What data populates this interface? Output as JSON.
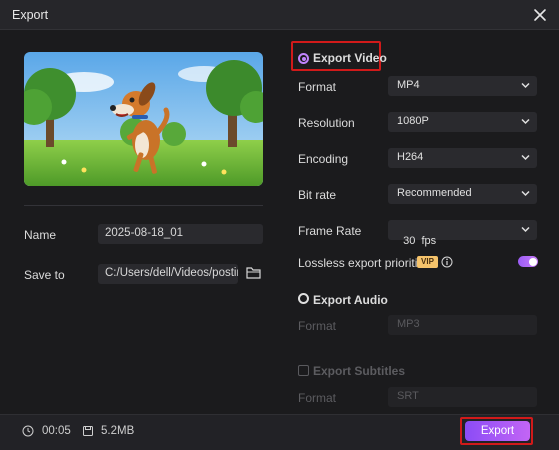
{
  "window": {
    "title": "Export"
  },
  "left": {
    "thumbnail_icon": "cartoon-dog-thumbnail",
    "name_label": "Name",
    "name_value": "2025-08-18_01",
    "save_label": "Save to",
    "save_path": "C:/Users/dell/Videos/posting"
  },
  "video": {
    "section_label": "Export Video",
    "selected": true,
    "rows": [
      {
        "label": "Format",
        "value": "MP4"
      },
      {
        "label": "Resolution",
        "value": "1080P"
      },
      {
        "label": "Encoding",
        "value": "H264"
      },
      {
        "label": "Bit rate",
        "value": "Recommended"
      },
      {
        "label": "Frame Rate",
        "value": "30  fps"
      }
    ],
    "lossless_label": "Lossless export prioritized",
    "vip_badge": "VIP",
    "lossless_on": true
  },
  "audio": {
    "section_label": "Export Audio",
    "format_label": "Format",
    "format_value": "MP3"
  },
  "subtitles": {
    "section_label": "Export Subtitles",
    "format_label": "Format",
    "format_value": "SRT"
  },
  "footer": {
    "duration": "00:05",
    "size": "5.2MB",
    "export_label": "Export"
  },
  "colors": {
    "accent": "#c084fc",
    "highlight_box": "#d11a1a",
    "background": "#1b1b1d"
  }
}
